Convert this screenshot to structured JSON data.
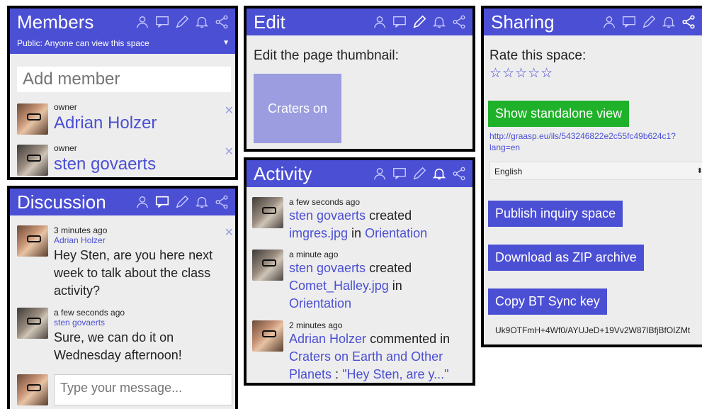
{
  "members": {
    "title": "Members",
    "visibility": "Public: Anyone can view this space",
    "add_placeholder": "Add member",
    "items": [
      {
        "role": "owner",
        "name": "Adrian Holzer"
      },
      {
        "role": "owner",
        "name": "sten govaerts"
      }
    ]
  },
  "edit": {
    "title": "Edit",
    "prompt": "Edit the page thumbnail:",
    "thumbnail_text": "Craters on"
  },
  "sharing": {
    "title": "Sharing",
    "rate_label": "Rate this space:",
    "stars": "☆☆☆☆☆",
    "standalone_btn": "Show standalone view",
    "url_line1": "http://graasp.eu/ils/543246822e2c55fc49b624c1?",
    "url_line2": "lang=en",
    "language": "English",
    "publish_btn": "Publish inquiry space",
    "zip_btn": "Download as ZIP archive",
    "sync_btn": "Copy BT Sync key",
    "sync_key": "Uk9OTFmH+4Wf0/AYUJeD+19Vv2W87IBfjBfOIZMt"
  },
  "discussion": {
    "title": "Discussion",
    "messages": [
      {
        "time": "3 minutes ago",
        "author": "Adrian Holzer",
        "text": "Hey Sten, are you here next week to talk about the class activity?"
      },
      {
        "time": "a few seconds ago",
        "author": "sten govaerts",
        "text": "Sure, we can do it on Wednesday afternoon!"
      }
    ],
    "input_placeholder": "Type your message..."
  },
  "activity": {
    "title": "Activity",
    "items": [
      {
        "time": "a few seconds ago",
        "actor": "sten govaerts",
        "verb": "created",
        "object": "imgres.jpg",
        "prep": "in",
        "target": "Orientation"
      },
      {
        "time": "a minute ago",
        "actor": "sten govaerts",
        "verb": "created",
        "object": "Comet_Halley.jpg",
        "prep": "in",
        "target": "Orientation"
      },
      {
        "time": "2 minutes ago",
        "actor": "Adrian Holzer",
        "verb": "commented in",
        "object": "Craters on Earth and Other Planets",
        "sep": " : ",
        "quote": "\"Hey Sten, are y...\""
      }
    ]
  },
  "icon_names": [
    "user-icon",
    "chat-icon",
    "pencil-icon",
    "bell-icon",
    "share-icon"
  ],
  "colors": {
    "accent": "#4b4fd4",
    "green": "#1fb129",
    "panel_bg": "#ededed"
  }
}
